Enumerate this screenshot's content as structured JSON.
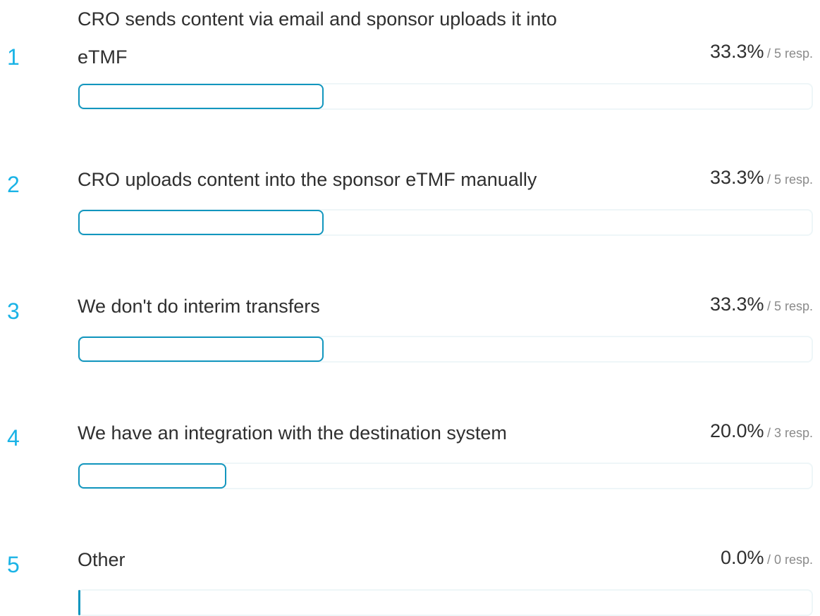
{
  "chart_data": {
    "type": "bar",
    "orientation": "horizontal",
    "categories": [
      "CRO sends content via email and sponsor uploads it into eTMF",
      "CRO uploads content into the sponsor eTMF manually",
      "We don't do interim transfers",
      "We have an integration with the destination system",
      "Other"
    ],
    "values": [
      33.3,
      33.3,
      33.3,
      20.0,
      0.0
    ],
    "xlim": [
      0,
      100
    ]
  },
  "rows": [
    {
      "rank": "1",
      "label_line1": "CRO sends content via email and sponsor uploads it into",
      "label_line2": "eTMF",
      "percent": "33.3%",
      "responses": "/ 5 resp."
    },
    {
      "rank": "2",
      "label_line1": "CRO uploads content into the sponsor eTMF manually",
      "percent": "33.3%",
      "responses": "/ 5 resp."
    },
    {
      "rank": "3",
      "label_line1": "We don't do interim transfers",
      "percent": "33.3%",
      "responses": "/ 5 resp."
    },
    {
      "rank": "4",
      "label_line1": "We have an integration with the destination system",
      "percent": "20.0%",
      "responses": "/ 3 resp."
    },
    {
      "rank": "5",
      "label_line1": "Other",
      "percent": "0.0%",
      "responses": "/ 0 resp."
    }
  ],
  "colors": {
    "accent": "#1ab3e6",
    "bar_border": "#1296be",
    "track_border": "#eef6f8"
  }
}
